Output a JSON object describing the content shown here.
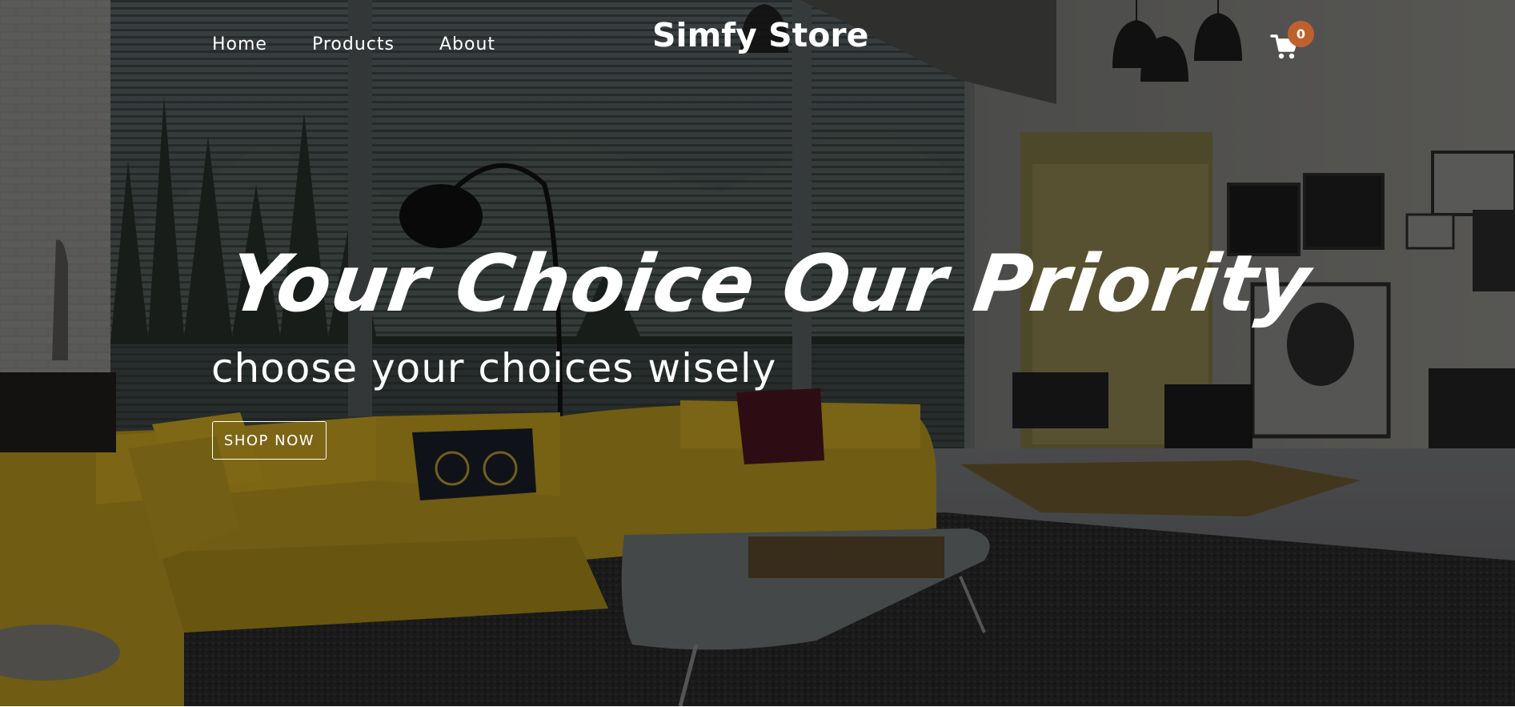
{
  "nav": {
    "links": [
      {
        "label": "Home"
      },
      {
        "label": "Products"
      },
      {
        "label": "About"
      }
    ],
    "brand": "Simfy Store",
    "cart": {
      "icon": "cart-icon",
      "count": "0",
      "badge_color": "#c0612d"
    }
  },
  "hero": {
    "headline": "Your Choice Our Priority",
    "subheadline": "choose your choices wisely",
    "cta_label": "SHOP NOW",
    "background": "living-room-photo"
  }
}
